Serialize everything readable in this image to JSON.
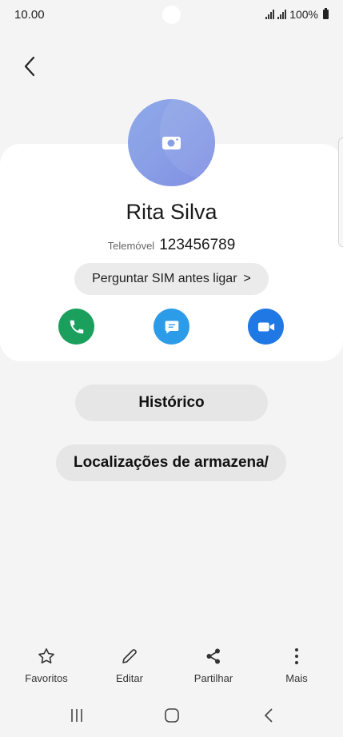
{
  "status_bar": {
    "time": "10.00",
    "battery": "100%"
  },
  "contact": {
    "name": "Rita Silva",
    "phone_type": "Telemóvel",
    "phone_number": "123456789"
  },
  "sim_prompt": {
    "label": "Perguntar SIM antes ligar",
    "chevron": ">"
  },
  "actions": [
    {
      "icon": "phone-icon",
      "color": "#1aa05c"
    },
    {
      "icon": "message-icon",
      "color": "#2d9ce8"
    },
    {
      "icon": "video-icon",
      "color": "#1f78e4"
    }
  ],
  "buttons": {
    "history": "Histórico",
    "storage_locations": "Localizações de armazena/"
  },
  "bottom_bar": {
    "favorites": "Favoritos",
    "edit": "Editar",
    "share": "Partilhar",
    "more": "Mais"
  },
  "colors": {
    "avatar": "#8ea7ea",
    "background": "#f4f4f4",
    "card": "#ffffff"
  }
}
